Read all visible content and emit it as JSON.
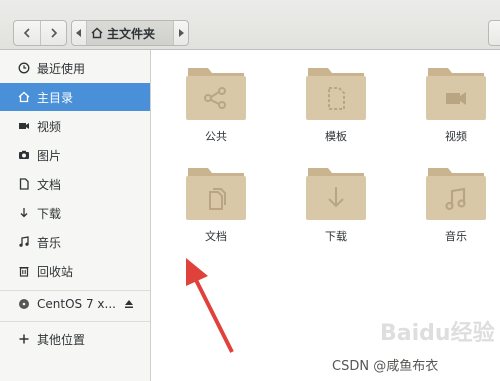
{
  "header": {
    "path_current": "主文件夹"
  },
  "sidebar": {
    "items": [
      {
        "label": "最近使用",
        "icon": "clock-icon"
      },
      {
        "label": "主目录",
        "icon": "home-icon",
        "active": true
      },
      {
        "label": "视频",
        "icon": "video-icon"
      },
      {
        "label": "图片",
        "icon": "camera-icon"
      },
      {
        "label": "文档",
        "icon": "document-icon"
      },
      {
        "label": "下载",
        "icon": "download-icon"
      },
      {
        "label": "音乐",
        "icon": "music-icon"
      },
      {
        "label": "回收站",
        "icon": "trash-icon"
      }
    ],
    "device": {
      "label": "CentOS 7 x...",
      "icon": "disc-icon",
      "action_icon": "eject-icon"
    },
    "other": {
      "label": "其他位置",
      "icon": "plus-icon"
    }
  },
  "folders": [
    {
      "label": "公共",
      "icon": "share-emblem"
    },
    {
      "label": "模板",
      "icon": "template-emblem"
    },
    {
      "label": "视频",
      "icon": "video-emblem"
    },
    {
      "label": "文档",
      "icon": "documents-emblem"
    },
    {
      "label": "下载",
      "icon": "download-emblem"
    },
    {
      "label": "音乐",
      "icon": "music-emblem"
    }
  ],
  "watermark": "CSDN @咸鱼布衣",
  "watermark_logo": "Baidu经验",
  "colors": {
    "accent": "#4a90d9",
    "folder": "#d8c8a8",
    "folder_tab": "#c9b48f",
    "arrow": "#e0413a"
  }
}
